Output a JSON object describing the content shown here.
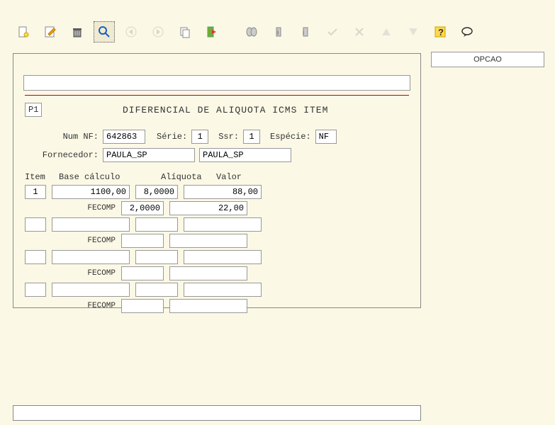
{
  "toolbar": {
    "icons": [
      "new",
      "edit",
      "delete",
      "search",
      "prev",
      "next",
      "copy",
      "exit",
      "filter",
      "info",
      "info2",
      "confirm",
      "cancel",
      "up",
      "down",
      "help",
      "comment"
    ]
  },
  "opcao_label": "OPCAO",
  "panel": {
    "p1": "P1",
    "title": "DIFERENCIAL DE ALIQUOTA ICMS ITEM",
    "labels": {
      "num_nf": "Num NF:",
      "serie": "Série:",
      "ssr": "Ssr:",
      "especie": "Espécie:",
      "fornecedor": "Fornecedor:"
    },
    "values": {
      "num_nf": "642863",
      "serie": "1",
      "ssr": "1",
      "especie": "NF",
      "fornecedor1": "PAULA_SP",
      "fornecedor2": "PAULA_SP"
    },
    "columns": {
      "item": "Item",
      "base": "Base cálculo",
      "aliquota": "Alíquota",
      "valor": "Valor",
      "fecomp": "FECOMP"
    },
    "rows": [
      {
        "item": "1",
        "base": "1100,00",
        "aliq": "8,0000",
        "valor": "88,00",
        "fe_aliq": "2,0000",
        "fe_valor": "22,00"
      },
      {
        "item": "",
        "base": "",
        "aliq": "",
        "valor": "",
        "fe_aliq": "",
        "fe_valor": ""
      },
      {
        "item": "",
        "base": "",
        "aliq": "",
        "valor": "",
        "fe_aliq": "",
        "fe_valor": ""
      },
      {
        "item": "",
        "base": "",
        "aliq": "",
        "valor": "",
        "fe_aliq": "",
        "fe_valor": ""
      }
    ]
  }
}
